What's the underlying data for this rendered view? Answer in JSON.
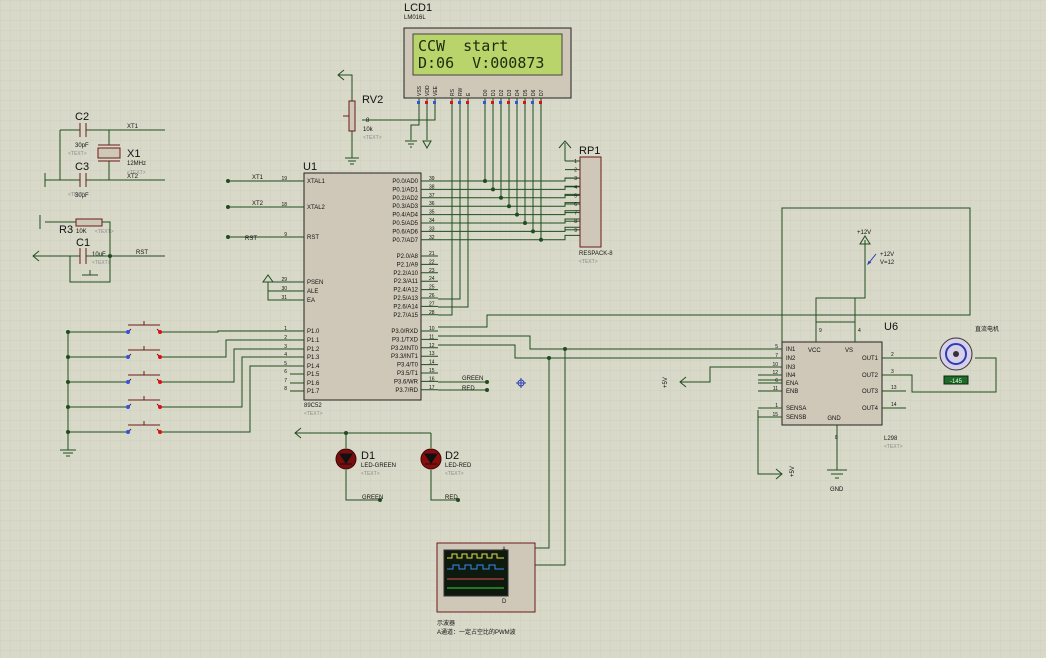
{
  "lcd": {
    "ref": "LCD1",
    "type": "LM016L",
    "line1": "CCW  start",
    "line2": "D:06  V:000873",
    "pins": [
      "VSS",
      "VDD",
      "VEE",
      "RS",
      "RW",
      "E",
      "D0",
      "D1",
      "D2",
      "D3",
      "D4",
      "D5",
      "D6",
      "D7"
    ],
    "pin_numbers": [
      "1",
      "2",
      "3",
      "4",
      "5",
      "6",
      "7",
      "8",
      "9",
      "10",
      "11",
      "12",
      "13",
      "14"
    ]
  },
  "rv2": {
    "ref": "RV2",
    "value": "10k",
    "mark": "8"
  },
  "c2": {
    "ref": "C2",
    "value": "30pF"
  },
  "c3": {
    "ref": "C3",
    "value": "30pF"
  },
  "x1": {
    "ref": "X1",
    "value": "12MHz"
  },
  "r3": {
    "ref": "R3",
    "value": "10K"
  },
  "c1": {
    "ref": "C1",
    "value": "10uF"
  },
  "rp1": {
    "ref": "RP1",
    "type": "RESPACK-8",
    "pins": [
      "1",
      "2",
      "3",
      "4",
      "5",
      "6",
      "7",
      "8",
      "9"
    ]
  },
  "u1": {
    "ref": "U1",
    "type": "89C52",
    "left_pins": [
      {
        "name": "XTAL1",
        "num": "19"
      },
      {
        "name": "XTAL2",
        "num": "18"
      },
      {
        "name": "RST",
        "num": "9"
      },
      {
        "name": "PSEN",
        "num": "29"
      },
      {
        "name": "ALE",
        "num": "30"
      },
      {
        "name": "EA",
        "num": "31"
      },
      {
        "name": "P1.0",
        "num": "1"
      },
      {
        "name": "P1.1",
        "num": "2"
      },
      {
        "name": "P1.2",
        "num": "3"
      },
      {
        "name": "P1.3",
        "num": "4"
      },
      {
        "name": "P1.4",
        "num": "5"
      },
      {
        "name": "P1.5",
        "num": "6"
      },
      {
        "name": "P1.6",
        "num": "7"
      },
      {
        "name": "P1.7",
        "num": "8"
      }
    ],
    "p0_pins": [
      {
        "name": "P0.0/AD0",
        "num": "39"
      },
      {
        "name": "P0.1/AD1",
        "num": "38"
      },
      {
        "name": "P0.2/AD2",
        "num": "37"
      },
      {
        "name": "P0.3/AD3",
        "num": "36"
      },
      {
        "name": "P0.4/AD4",
        "num": "35"
      },
      {
        "name": "P0.5/AD5",
        "num": "34"
      },
      {
        "name": "P0.6/AD6",
        "num": "33"
      },
      {
        "name": "P0.7/AD7",
        "num": "32"
      }
    ],
    "p2_pins": [
      {
        "name": "P2.0/A8",
        "num": "21"
      },
      {
        "name": "P2.1/A9",
        "num": "22"
      },
      {
        "name": "P2.2/A10",
        "num": "23"
      },
      {
        "name": "P2.3/A11",
        "num": "24"
      },
      {
        "name": "P2.4/A12",
        "num": "25"
      },
      {
        "name": "P2.5/A13",
        "num": "26"
      },
      {
        "name": "P2.6/A14",
        "num": "27"
      },
      {
        "name": "P2.7/A15",
        "num": "28"
      }
    ],
    "p3_pins": [
      {
        "name": "P3.0/RXD",
        "num": "10"
      },
      {
        "name": "P3.1/TXD",
        "num": "11"
      },
      {
        "name": "P3.2/INT0",
        "num": "12"
      },
      {
        "name": "P3.3/INT1",
        "num": "13"
      },
      {
        "name": "P3.4/T0",
        "num": "14"
      },
      {
        "name": "P3.5/T1",
        "num": "15"
      },
      {
        "name": "P3.6/WR",
        "num": "16"
      },
      {
        "name": "P3.7/RD",
        "num": "17"
      }
    ]
  },
  "u6": {
    "ref": "U6",
    "type": "L298",
    "left_pins": [
      {
        "name": "IN1",
        "num": "5"
      },
      {
        "name": "IN2",
        "num": "7"
      },
      {
        "name": "IN3",
        "num": "10"
      },
      {
        "name": "IN4",
        "num": "12"
      },
      {
        "name": "ENA",
        "num": "6"
      },
      {
        "name": "ENB",
        "num": "11"
      },
      {
        "name": "SENSA",
        "num": "1"
      },
      {
        "name": "SENSB",
        "num": "15"
      }
    ],
    "right_pins": [
      {
        "name": "OUT1",
        "num": "2"
      },
      {
        "name": "OUT2",
        "num": "3"
      },
      {
        "name": "OUT3",
        "num": "13"
      },
      {
        "name": "OUT4",
        "num": "14"
      }
    ],
    "top_pins": [
      {
        "name": "VCC",
        "num": "9"
      },
      {
        "name": "VS",
        "num": "4"
      }
    ],
    "gnd_pin": {
      "name": "GND",
      "num": "8"
    }
  },
  "motor": {
    "label": "直流电机",
    "readout": "-145"
  },
  "d1": {
    "ref": "D1",
    "type": "LED-GREEN",
    "net": "GREEN"
  },
  "d2": {
    "ref": "D2",
    "type": "LED-RED",
    "net": "RED"
  },
  "scope": {
    "channels": [
      "A",
      "B",
      "C",
      "D"
    ],
    "caption": "示波器",
    "note": "A通道：一定占空比的PWM波"
  },
  "supply": {
    "v12": "+12V",
    "v12_probe": "+12V",
    "v12_probe_value": "V=12",
    "v5": "+5V",
    "gnd": "GND"
  },
  "nets": {
    "xt1": "XT1",
    "xt2": "XT2",
    "rst": "RST",
    "green": "GREEN",
    "red": "RED"
  },
  "placeholder": "<TEXT>",
  "colors": {
    "sheet": "#d9d9c9",
    "wire": "#1f4d1f",
    "component": "#6b1a1a",
    "lcd_screen": "#b8d46a"
  }
}
